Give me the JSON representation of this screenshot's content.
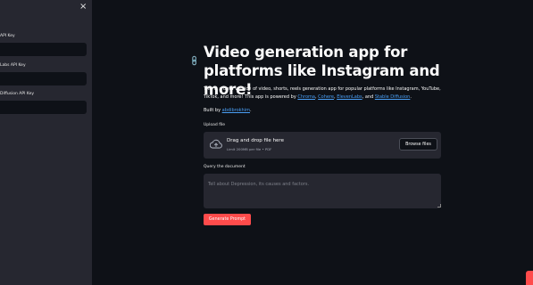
{
  "sidebar": {
    "close_label": "×",
    "fields": [
      {
        "label": "API Key"
      },
      {
        "label": "Labs API Key"
      },
      {
        "label": "Diffusion API Key"
      }
    ]
  },
  "main": {
    "link_icon": "🔗",
    "title": "Video generation app for platforms like Instagram and more!",
    "desc_pre": "This is a Beta version of video, shorts, reels generation app for popular platforms like Instagram, YouTube, TikTok, and more! This app is powered by ",
    "links": [
      "Chroma",
      "Cohere",
      "ElevenLabs",
      "Stable Diffusion"
    ],
    "sep_1": ", ",
    "sep_2": ", ",
    "sep_3": ", and ",
    "desc_end": ".",
    "built_pre": "Built by ",
    "author": "abdibrokhim",
    "built_end": ".",
    "upload": {
      "label": "Upload file",
      "title": "Drag and drop file here",
      "limit": "Limit 200MB per file • PDF",
      "browse": "Browse files"
    },
    "query": {
      "label": "Query the document",
      "placeholder": "Tell about Depression, its causes and factors."
    },
    "generate_label": "Generate Prompt"
  },
  "colors": {
    "background": "#0e1117",
    "sidebar": "#262730",
    "accent": "#ff4b4b",
    "link": "#4a9ff5"
  },
  "icons": [
    "close-icon",
    "link-icon",
    "cloud-upload-icon"
  ]
}
